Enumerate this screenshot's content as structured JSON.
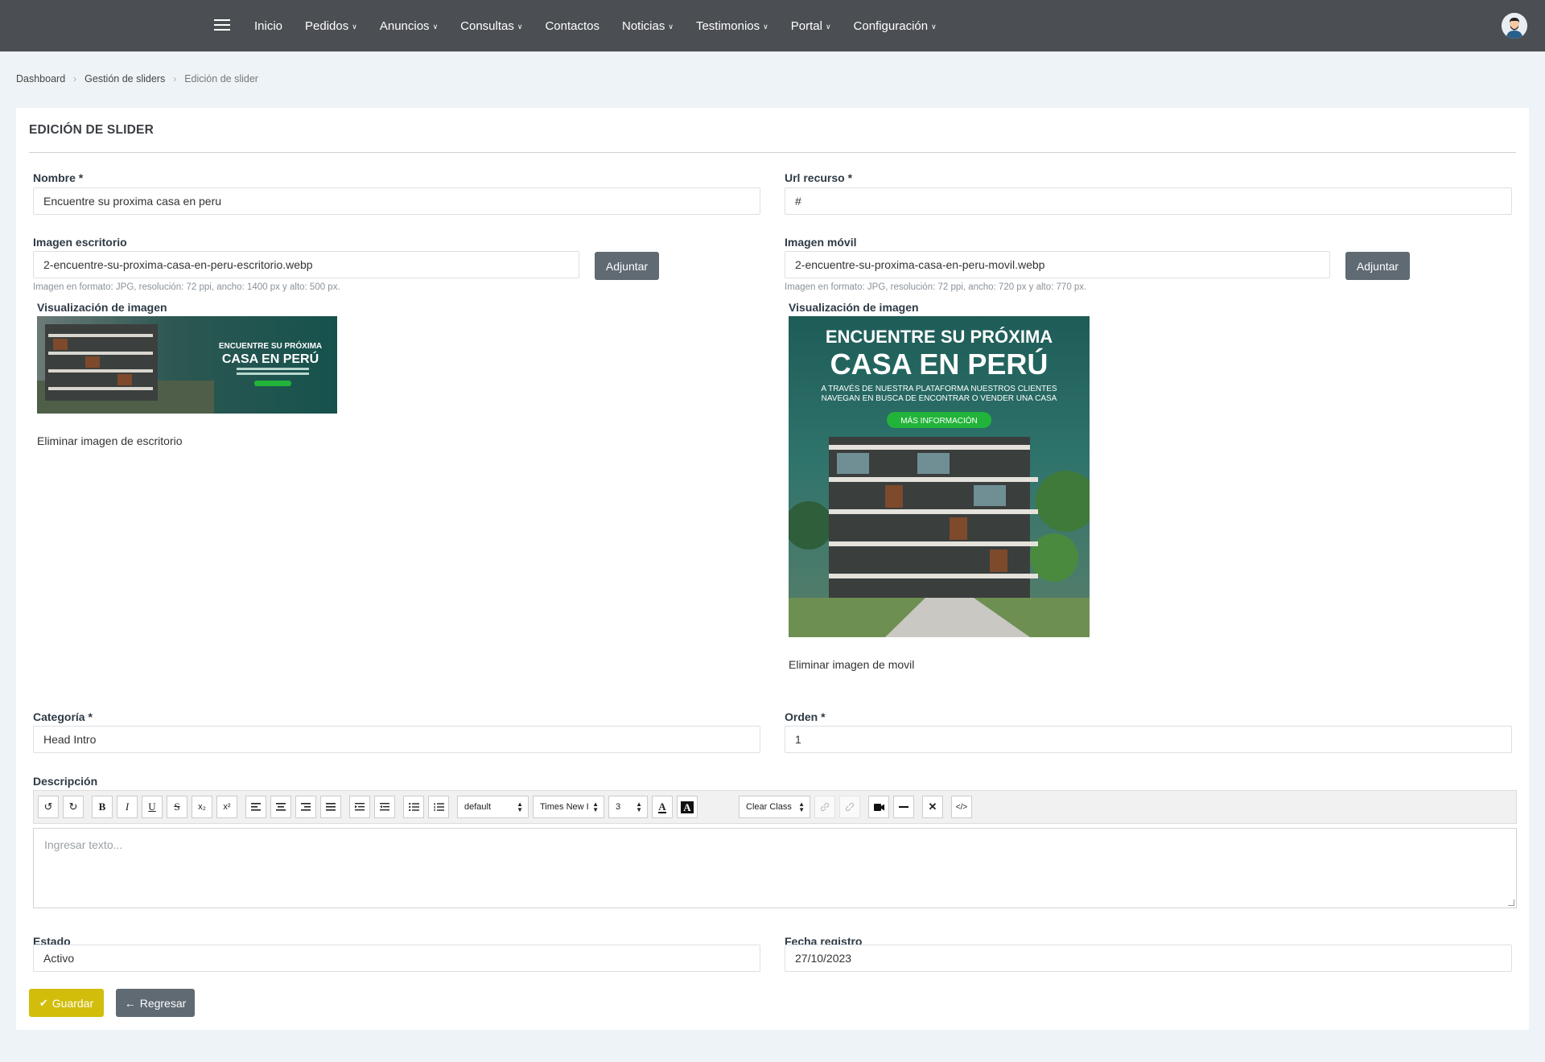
{
  "nav": {
    "items": [
      {
        "label": "Inicio",
        "dropdown": false
      },
      {
        "label": "Pedidos",
        "dropdown": true
      },
      {
        "label": "Anuncios",
        "dropdown": true
      },
      {
        "label": "Consultas",
        "dropdown": true
      },
      {
        "label": "Contactos",
        "dropdown": false
      },
      {
        "label": "Noticias",
        "dropdown": true
      },
      {
        "label": "Testimonios",
        "dropdown": true
      },
      {
        "label": "Portal",
        "dropdown": true
      },
      {
        "label": "Configuración",
        "dropdown": true
      }
    ]
  },
  "breadcrumb": [
    "Dashboard",
    "Gestión de sliders",
    "Edición de slider"
  ],
  "card": {
    "title": "EDICIÓN DE SLIDER"
  },
  "form": {
    "nombre": {
      "label": "Nombre *",
      "value": "Encuentre su proxima casa en peru"
    },
    "url": {
      "label": "Url recurso *",
      "value": "#"
    },
    "img_desk": {
      "label": "Imagen escritorio",
      "value": "2-encuentre-su-proxima-casa-en-peru-escritorio.webp",
      "button": "Adjuntar",
      "help": "Imagen en formato: JPG, resolución: 72 ppi, ancho: 1400 px y alto: 500 px.",
      "preview_label": "Visualización de imagen",
      "delete": "Eliminar imagen de escritorio"
    },
    "img_mob": {
      "label": "Imagen móvil",
      "value": "2-encuentre-su-proxima-casa-en-peru-movil.webp",
      "button": "Adjuntar",
      "help": "Imagen en formato: JPG, resolución: 72 ppi, ancho: 720 px y alto: 770 px.",
      "preview_label": "Visualización de imagen",
      "delete": "Eliminar imagen de movil"
    },
    "categoria": {
      "label": "Categoría *",
      "value": "Head Intro"
    },
    "orden": {
      "label": "Orden *",
      "value": "1"
    },
    "descripcion": {
      "label": "Descripción",
      "placeholder": "Ingresar texto...",
      "toolbar": {
        "undo": "↺",
        "redo": "↻",
        "bold": "B",
        "italic": "I",
        "underline": "U",
        "strike": "S",
        "sub": "x₂",
        "sup": "x²",
        "style_select": "default",
        "font_select": "Times New I",
        "size_select": "3",
        "clear_class": "Clear Class",
        "code": "</>"
      }
    },
    "estado": {
      "label": "Estado",
      "value": "Activo"
    },
    "fecha": {
      "label": "Fecha registro",
      "value": "27/10/2023"
    }
  },
  "banner": {
    "headline_1": "ENCUENTRE SU PRÓXIMA",
    "headline_2": "CASA EN PERÚ",
    "sub_1": "A TRAVÉS DE NUESTRA PLATAFORMA NUESTROS CLIENTES",
    "sub_2": "NAVEGAN EN BUSCA DE ENCONTRAR O VENDER UNA CASA",
    "cta": "MÁS INFORMACIÓN",
    "cta_color": "#22b33a"
  },
  "actions": {
    "save": "Guardar",
    "back": "Regresar"
  },
  "colors": {
    "topbar": "#4b4f53",
    "save": "#d2bd0a",
    "secondary": "#5f6a72"
  }
}
